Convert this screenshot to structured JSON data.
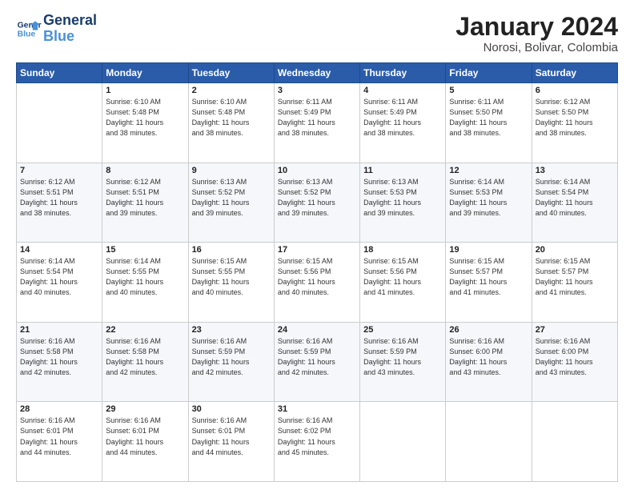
{
  "logo": {
    "line1": "General",
    "line2": "Blue"
  },
  "header": {
    "month_year": "January 2024",
    "location": "Norosi, Bolivar, Colombia"
  },
  "weekdays": [
    "Sunday",
    "Monday",
    "Tuesday",
    "Wednesday",
    "Thursday",
    "Friday",
    "Saturday"
  ],
  "weeks": [
    [
      {
        "day": "",
        "content": ""
      },
      {
        "day": "1",
        "content": "Sunrise: 6:10 AM\nSunset: 5:48 PM\nDaylight: 11 hours\nand 38 minutes."
      },
      {
        "day": "2",
        "content": "Sunrise: 6:10 AM\nSunset: 5:48 PM\nDaylight: 11 hours\nand 38 minutes."
      },
      {
        "day": "3",
        "content": "Sunrise: 6:11 AM\nSunset: 5:49 PM\nDaylight: 11 hours\nand 38 minutes."
      },
      {
        "day": "4",
        "content": "Sunrise: 6:11 AM\nSunset: 5:49 PM\nDaylight: 11 hours\nand 38 minutes."
      },
      {
        "day": "5",
        "content": "Sunrise: 6:11 AM\nSunset: 5:50 PM\nDaylight: 11 hours\nand 38 minutes."
      },
      {
        "day": "6",
        "content": "Sunrise: 6:12 AM\nSunset: 5:50 PM\nDaylight: 11 hours\nand 38 minutes."
      }
    ],
    [
      {
        "day": "7",
        "content": ""
      },
      {
        "day": "8",
        "content": "Sunrise: 6:12 AM\nSunset: 5:51 PM\nDaylight: 11 hours\nand 39 minutes."
      },
      {
        "day": "9",
        "content": "Sunrise: 6:13 AM\nSunset: 5:52 PM\nDaylight: 11 hours\nand 39 minutes."
      },
      {
        "day": "10",
        "content": "Sunrise: 6:13 AM\nSunset: 5:52 PM\nDaylight: 11 hours\nand 39 minutes."
      },
      {
        "day": "11",
        "content": "Sunrise: 6:13 AM\nSunset: 5:53 PM\nDaylight: 11 hours\nand 39 minutes."
      },
      {
        "day": "12",
        "content": "Sunrise: 6:14 AM\nSunset: 5:53 PM\nDaylight: 11 hours\nand 39 minutes."
      },
      {
        "day": "13",
        "content": "Sunrise: 6:14 AM\nSunset: 5:54 PM\nDaylight: 11 hours\nand 40 minutes."
      }
    ],
    [
      {
        "day": "14",
        "content": "Sunrise: 6:14 AM\nSunset: 5:54 PM\nDaylight: 11 hours\nand 40 minutes."
      },
      {
        "day": "15",
        "content": "Sunrise: 6:14 AM\nSunset: 5:55 PM\nDaylight: 11 hours\nand 40 minutes."
      },
      {
        "day": "16",
        "content": "Sunrise: 6:15 AM\nSunset: 5:55 PM\nDaylight: 11 hours\nand 40 minutes."
      },
      {
        "day": "17",
        "content": "Sunrise: 6:15 AM\nSunset: 5:56 PM\nDaylight: 11 hours\nand 40 minutes."
      },
      {
        "day": "18",
        "content": "Sunrise: 6:15 AM\nSunset: 5:56 PM\nDaylight: 11 hours\nand 41 minutes."
      },
      {
        "day": "19",
        "content": "Sunrise: 6:15 AM\nSunset: 5:57 PM\nDaylight: 11 hours\nand 41 minutes."
      },
      {
        "day": "20",
        "content": "Sunrise: 6:15 AM\nSunset: 5:57 PM\nDaylight: 11 hours\nand 41 minutes."
      }
    ],
    [
      {
        "day": "21",
        "content": "Sunrise: 6:16 AM\nSunset: 5:58 PM\nDaylight: 11 hours\nand 42 minutes."
      },
      {
        "day": "22",
        "content": "Sunrise: 6:16 AM\nSunset: 5:58 PM\nDaylight: 11 hours\nand 42 minutes."
      },
      {
        "day": "23",
        "content": "Sunrise: 6:16 AM\nSunset: 5:59 PM\nDaylight: 11 hours\nand 42 minutes."
      },
      {
        "day": "24",
        "content": "Sunrise: 6:16 AM\nSunset: 5:59 PM\nDaylight: 11 hours\nand 42 minutes."
      },
      {
        "day": "25",
        "content": "Sunrise: 6:16 AM\nSunset: 5:59 PM\nDaylight: 11 hours\nand 43 minutes."
      },
      {
        "day": "26",
        "content": "Sunrise: 6:16 AM\nSunset: 6:00 PM\nDaylight: 11 hours\nand 43 minutes."
      },
      {
        "day": "27",
        "content": "Sunrise: 6:16 AM\nSunset: 6:00 PM\nDaylight: 11 hours\nand 43 minutes."
      }
    ],
    [
      {
        "day": "28",
        "content": "Sunrise: 6:16 AM\nSunset: 6:01 PM\nDaylight: 11 hours\nand 44 minutes."
      },
      {
        "day": "29",
        "content": "Sunrise: 6:16 AM\nSunset: 6:01 PM\nDaylight: 11 hours\nand 44 minutes."
      },
      {
        "day": "30",
        "content": "Sunrise: 6:16 AM\nSunset: 6:01 PM\nDaylight: 11 hours\nand 44 minutes."
      },
      {
        "day": "31",
        "content": "Sunrise: 6:16 AM\nSunset: 6:02 PM\nDaylight: 11 hours\nand 45 minutes."
      },
      {
        "day": "",
        "content": ""
      },
      {
        "day": "",
        "content": ""
      },
      {
        "day": "",
        "content": ""
      }
    ]
  ]
}
